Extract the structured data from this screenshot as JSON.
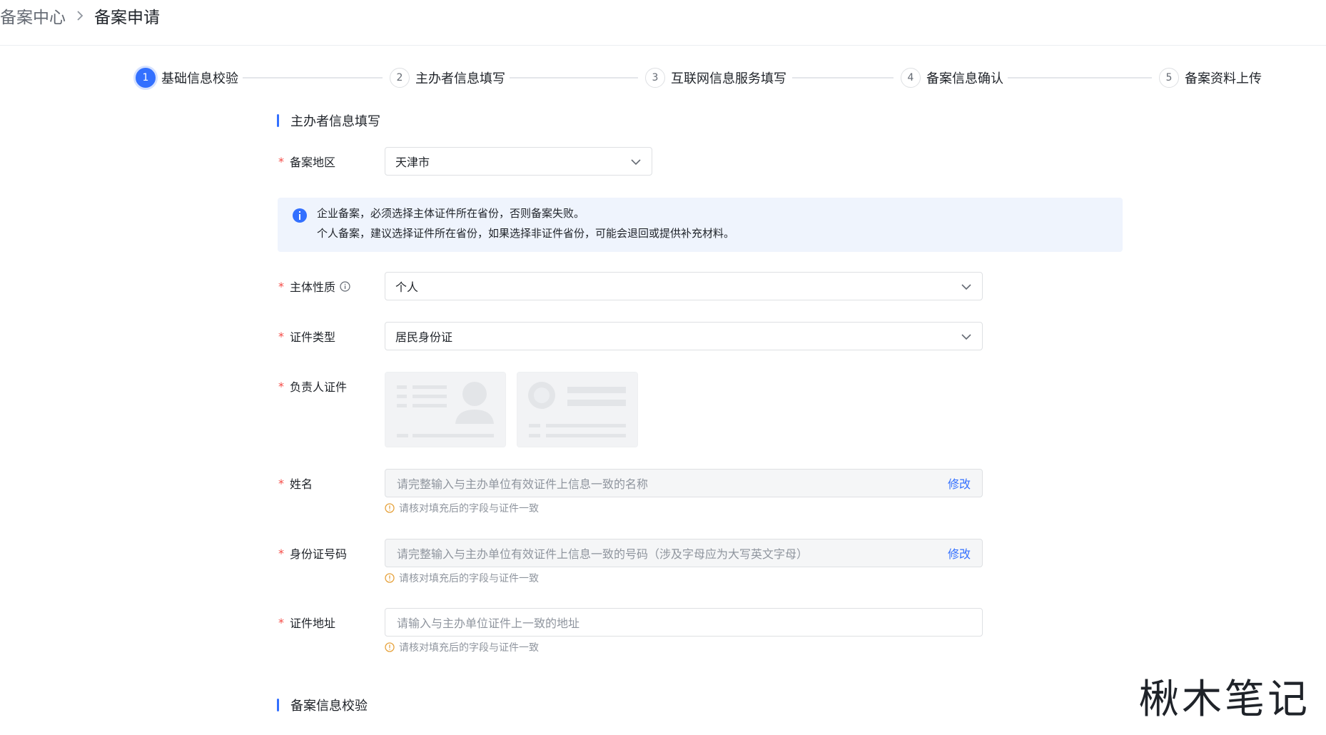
{
  "breadcrumb": {
    "root": "备案中心",
    "current": "备案申请"
  },
  "steps": [
    {
      "num": "1",
      "label": "基础信息校验",
      "active": true
    },
    {
      "num": "2",
      "label": "主办者信息填写",
      "active": false
    },
    {
      "num": "3",
      "label": "互联网信息服务填写",
      "active": false
    },
    {
      "num": "4",
      "label": "备案信息确认",
      "active": false
    },
    {
      "num": "5",
      "label": "备案资料上传",
      "active": false
    }
  ],
  "section1": {
    "title": "主办者信息填写"
  },
  "region": {
    "label": "备案地区",
    "value": "天津市"
  },
  "notice": {
    "line1": "企业备案，必须选择主体证件所在省份，否则备案失败。",
    "line2": "个人备案，建议选择证件所在省份，如果选择非证件省份，可能会退回或提供补充材料。"
  },
  "entity": {
    "label": "主体性质",
    "value": "个人"
  },
  "cert_type": {
    "label": "证件类型",
    "value": "居民身份证"
  },
  "id_card": {
    "label": "负责人证件"
  },
  "name_field": {
    "label": "姓名",
    "placeholder": "请完整输入与主办单位有效证件上信息一致的名称",
    "edit": "修改",
    "hint": "请核对填充后的字段与证件一致"
  },
  "id_number": {
    "label": "身份证号码",
    "placeholder": "请完整输入与主办单位有效证件上信息一致的号码（涉及字母应为大写英文字母）",
    "edit": "修改",
    "hint": "请核对填充后的字段与证件一致"
  },
  "address": {
    "label": "证件地址",
    "placeholder": "请输入与主办单位证件上一致的地址",
    "hint": "请核对填充后的字段与证件一致"
  },
  "section2": {
    "title": "备案信息校验"
  },
  "watermark": "楸木笔记",
  "colors": {
    "primary": "#3370ff",
    "required": "#f54a45",
    "warning": "#e6a23c",
    "notice_bg": "#eff4fd"
  },
  "icons": {
    "breadcrumb_sep": "chevron-right-icon",
    "select": "chevron-down-icon",
    "notice": "info-circle-icon",
    "hint": "warning-circle-icon"
  }
}
